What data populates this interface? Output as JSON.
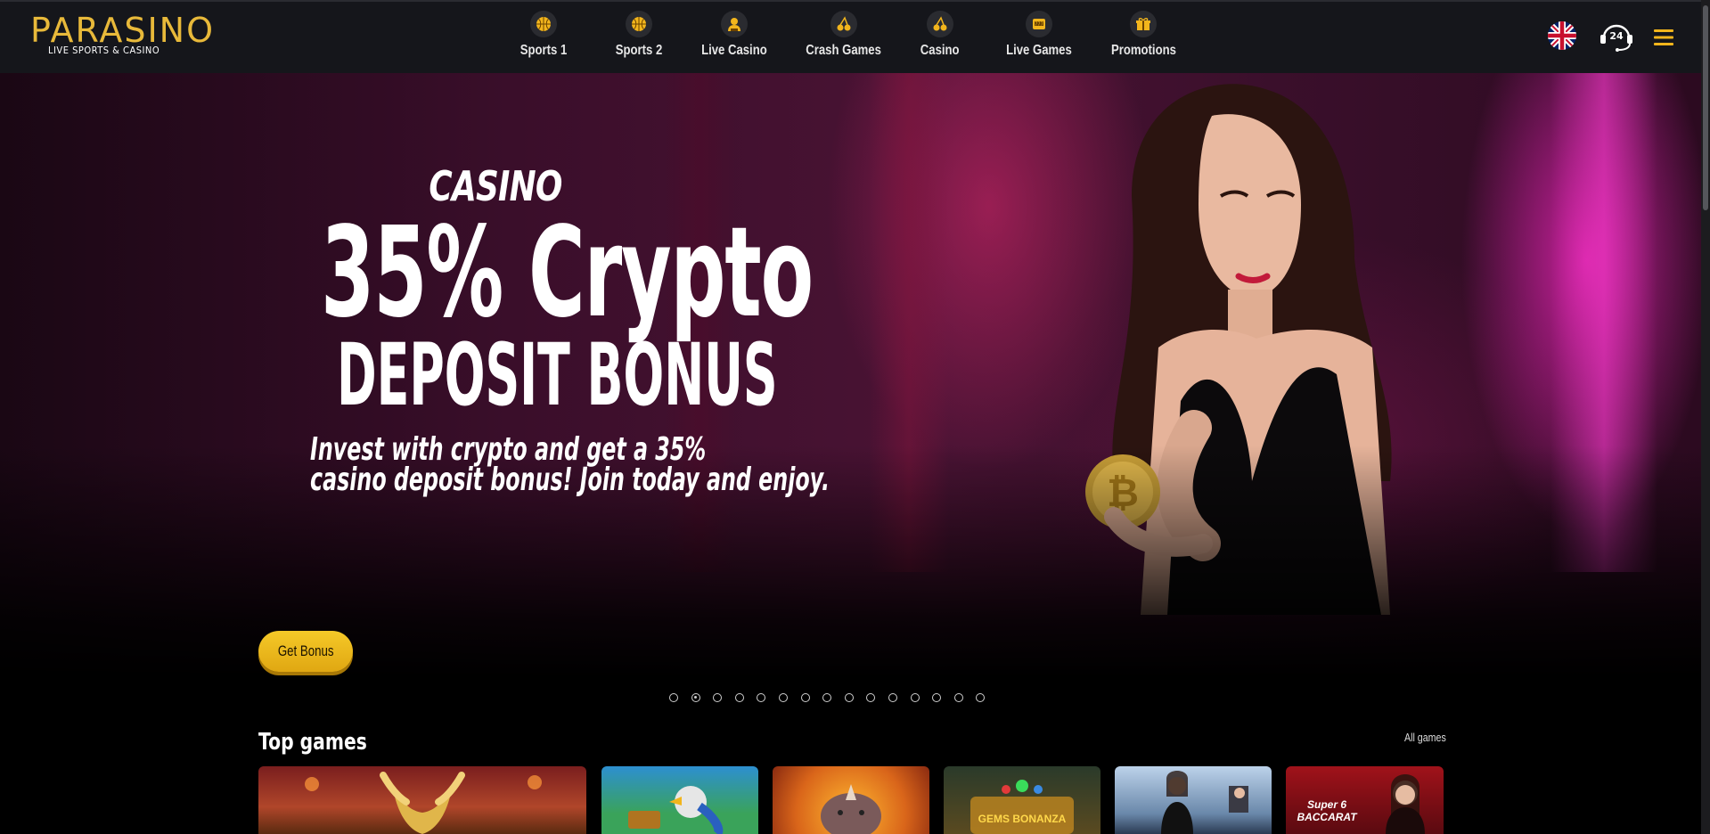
{
  "brand": {
    "name": "PARASINO",
    "tagline": "LIVE SPORTS & CASINO",
    "accent": "#e8b93a"
  },
  "nav": {
    "items": [
      {
        "label": "Sports 1",
        "icon": "basketball-icon"
      },
      {
        "label": "Sports 2",
        "icon": "basketball-icon"
      },
      {
        "label": "Live Casino",
        "icon": "dealer-icon"
      },
      {
        "label": "Crash Games",
        "icon": "cherries-icon"
      },
      {
        "label": "Casino",
        "icon": "cherries-icon"
      },
      {
        "label": "Live Games",
        "icon": "slot-machine-icon"
      },
      {
        "label": "Promotions",
        "icon": "gift-icon"
      }
    ]
  },
  "header_right": {
    "language_icon": "uk-flag-icon",
    "support_icon": "support-24-icon",
    "support_text": "24",
    "menu_icon": "hamburger-menu-icon"
  },
  "hero": {
    "eyebrow": "CASINO",
    "title": "35% Crypto",
    "subtitle": "DEPOSIT BONUS",
    "description_line1": "Invest with crypto and get a 35%",
    "description_line2": "casino deposit bonus! Join today and enjoy.",
    "cta_label": "Get Bonus",
    "slide_count": 15,
    "active_slide": 2
  },
  "top_games": {
    "title": "Top games",
    "all_label": "All games",
    "games": [
      {
        "name": "bull-slot",
        "label": ""
      },
      {
        "name": "parrot-treasure",
        "label": ""
      },
      {
        "name": "rhino-slot",
        "label": ""
      },
      {
        "name": "gems-bonanza",
        "label": "GEMS BONANZA"
      },
      {
        "name": "live-dealer-table",
        "label": ""
      },
      {
        "name": "super-6-baccarat",
        "label": "Super 6 BACCARAT"
      }
    ]
  },
  "colors": {
    "header_bg": "#15161b",
    "button_yellow": "#f5c928",
    "hero_pink": "#ff28c8"
  }
}
